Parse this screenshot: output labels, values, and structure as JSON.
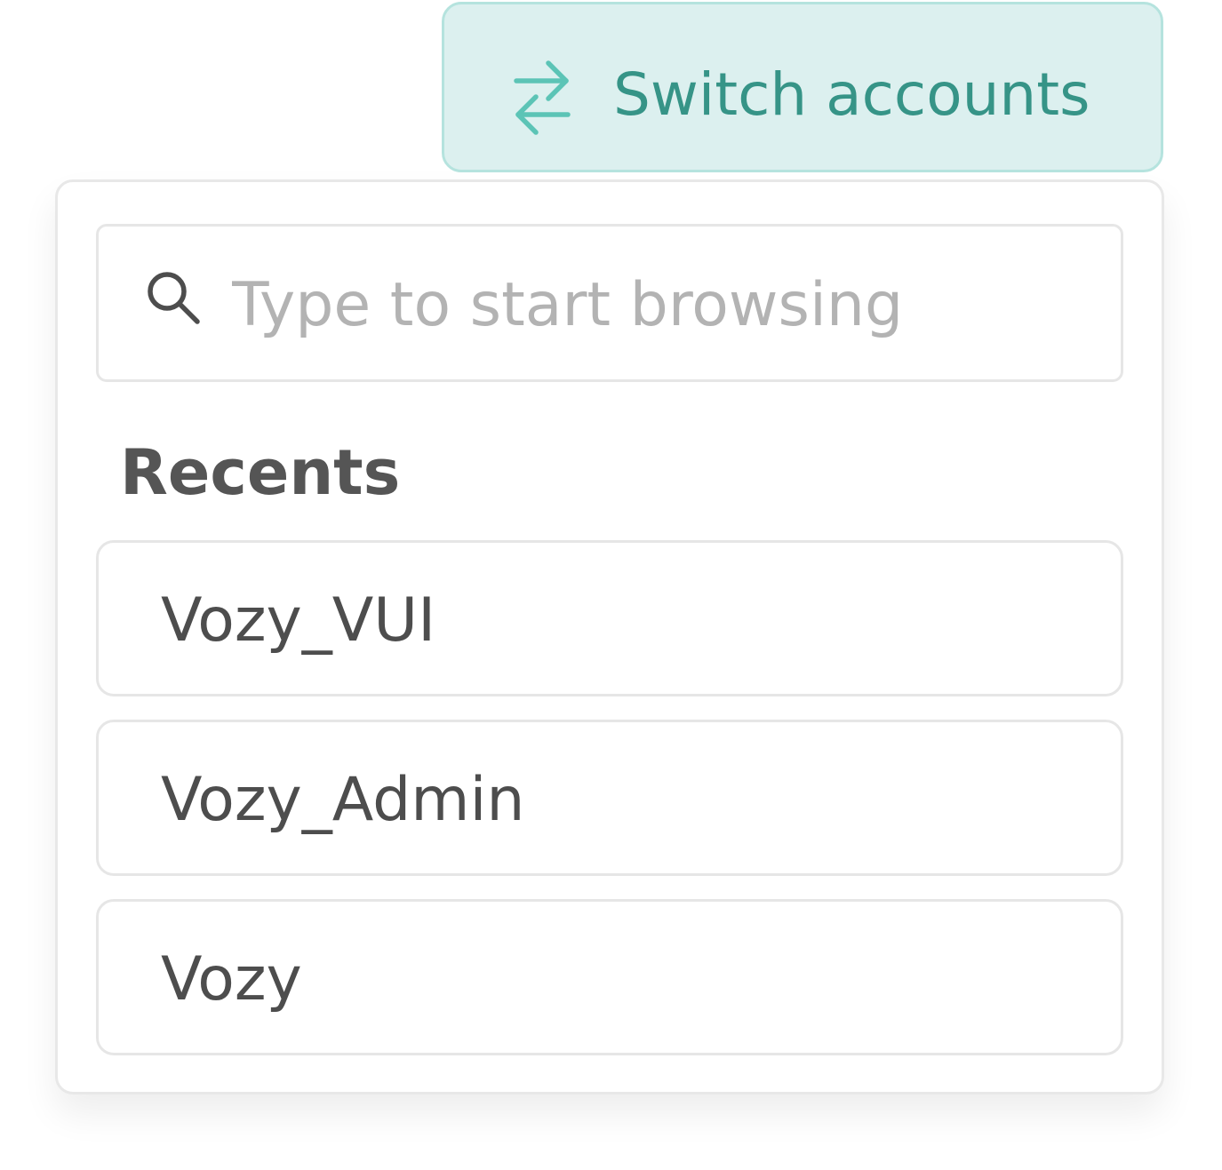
{
  "switch_button": {
    "label": "Switch accounts",
    "icon": "swap-arrows-icon",
    "accent_color": "#369487",
    "background_color": "#dcf0ef"
  },
  "search": {
    "placeholder": "Type to start browsing",
    "value": "",
    "icon": "search-icon"
  },
  "recents": {
    "title": "Recents",
    "items": [
      {
        "label": "Vozy_VUI"
      },
      {
        "label": "Vozy_Admin"
      },
      {
        "label": "Vozy"
      }
    ]
  }
}
